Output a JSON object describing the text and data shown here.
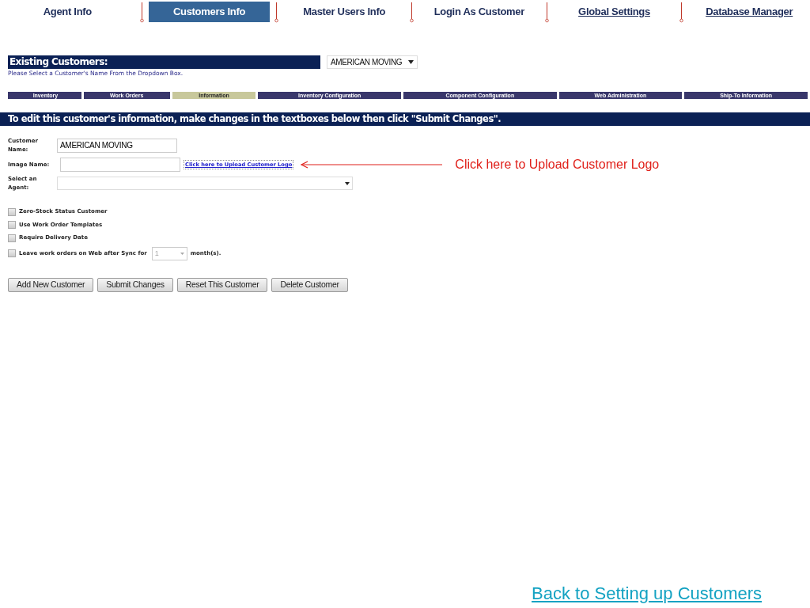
{
  "top_nav": [
    {
      "label": "Agent Info",
      "selected": false,
      "kind": "plain"
    },
    {
      "label": "Customers Info",
      "selected": true,
      "kind": "plain"
    },
    {
      "label": "Master Users Info",
      "selected": false,
      "kind": "plain"
    },
    {
      "label": "Login As Customer",
      "selected": false,
      "kind": "plain"
    },
    {
      "label": "Global Settings",
      "selected": false,
      "kind": "link"
    },
    {
      "label": "Database Manager",
      "selected": false,
      "kind": "link"
    }
  ],
  "existing_customers": {
    "title": "Existing Customers:",
    "dropdown_value": "AMERICAN MOVING",
    "hint": "Please Select a Customer's Name From the Dropdown Box."
  },
  "sub_tabs": [
    {
      "label": "Inventory",
      "selected": false
    },
    {
      "label": "Work Orders",
      "selected": false
    },
    {
      "label": "Information",
      "selected": true
    },
    {
      "label": "Inventory Configuration",
      "selected": false
    },
    {
      "label": "Component Configuration",
      "selected": false
    },
    {
      "label": "Web Administration",
      "selected": false
    },
    {
      "label": "Ship-To Information",
      "selected": false
    }
  ],
  "instruction": "To edit this customer's information, make changes in the textboxes below then click \"Submit Changes\".",
  "form": {
    "customer_name_label": "Customer Name:",
    "customer_name_value": "AMERICAN MOVING",
    "image_name_label": "Image Name:",
    "upload_link": "Click here to Upload Customer Logo",
    "agent_label": "Select an Agent:"
  },
  "options": [
    {
      "label": "Zero-Stock Status Customer",
      "checked": false
    },
    {
      "label": "Use Work Order Templates",
      "checked": false
    },
    {
      "label": "Require Delivery Date",
      "checked": false
    },
    {
      "label": "Leave work orders on Web after Sync for",
      "checked": false,
      "months_value": "1",
      "suffix": "month(s)."
    }
  ],
  "buttons": [
    "Add New Customer",
    "Submit Changes",
    "Reset This Customer",
    "Delete Customer"
  ],
  "callout": "Click here to Upload Customer Logo",
  "footer_link": "Back to Setting up Customers"
}
